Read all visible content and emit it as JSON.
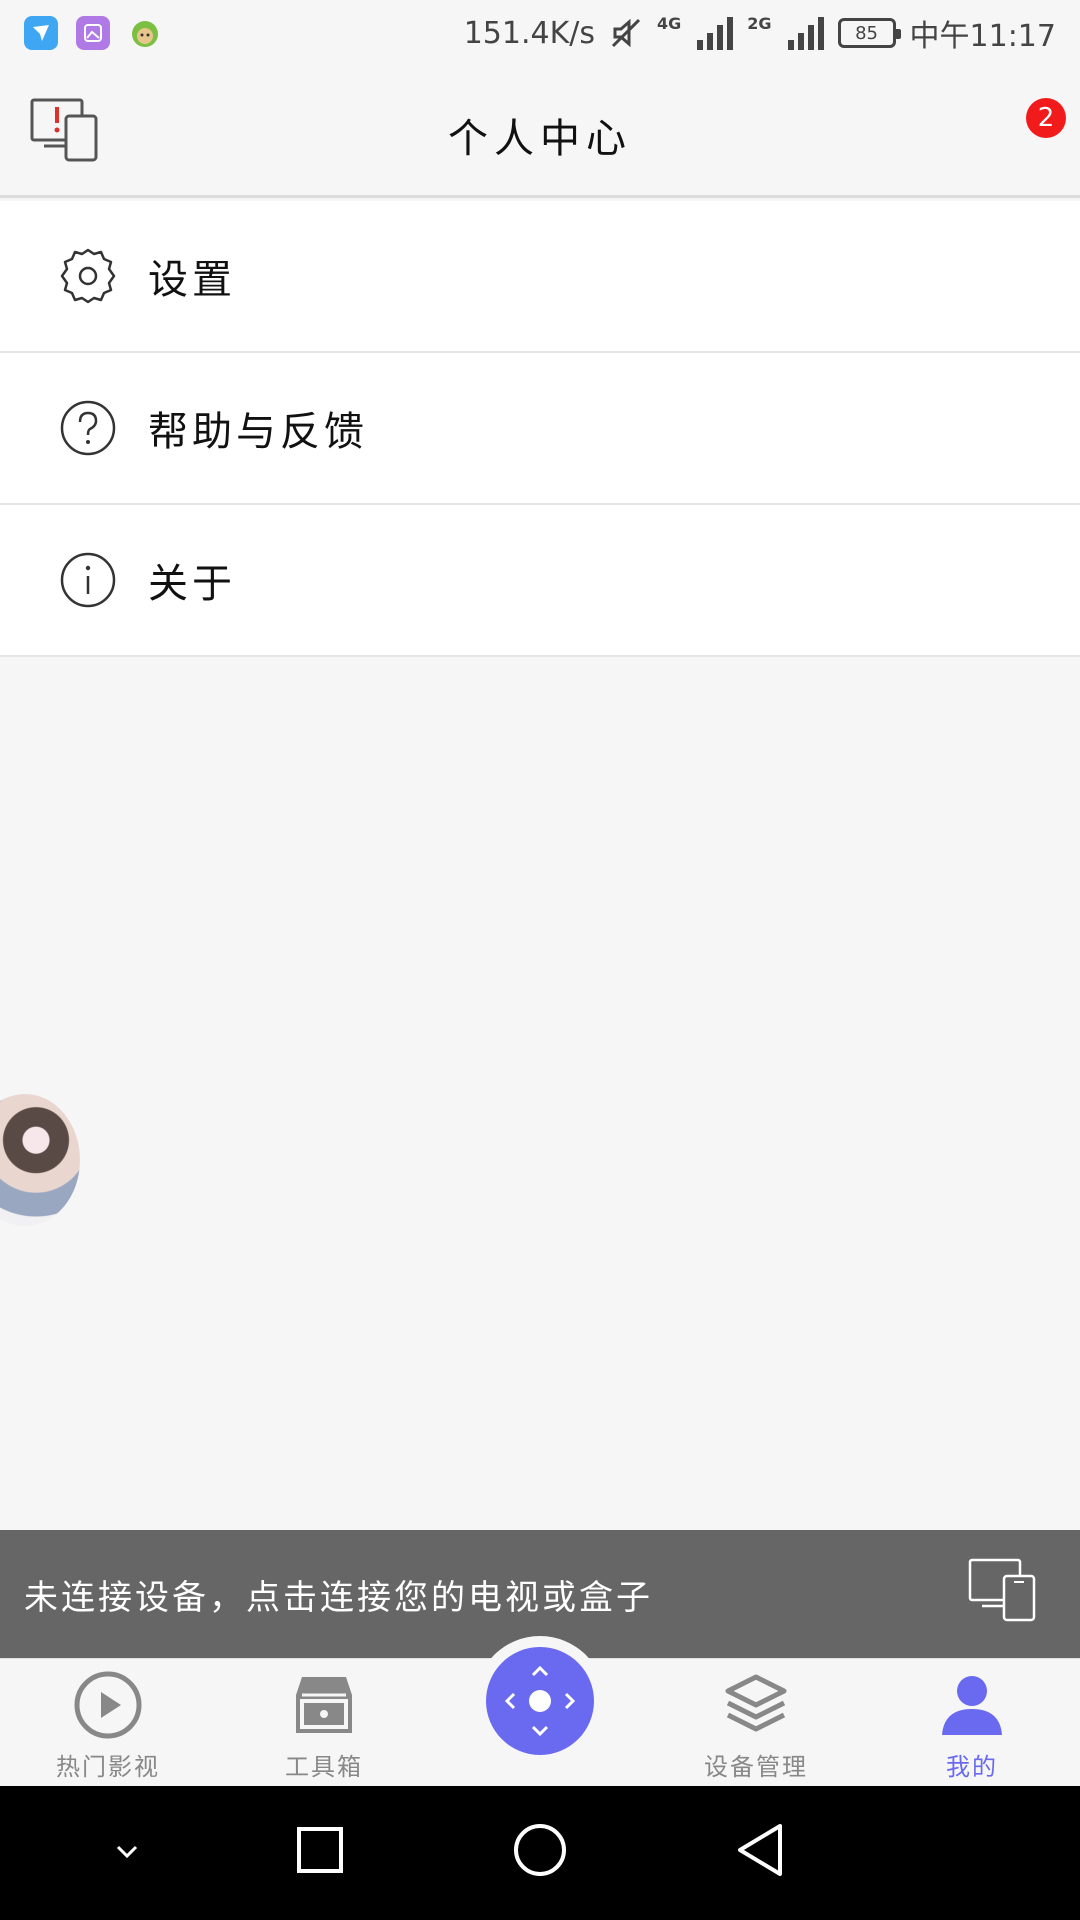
{
  "status_bar": {
    "speed": "151.4K/s",
    "net1": "4G",
    "net2": "2G",
    "battery": "85",
    "time": "中午11:17",
    "icons": [
      "message-app-icon",
      "gallery-app-icon",
      "monkey-app-icon",
      "mute-icon",
      "signal-icon",
      "battery-icon"
    ]
  },
  "header": {
    "title": "个人中心",
    "notification_count": "2",
    "left_icon": "device-screen-icon"
  },
  "menu": {
    "items": [
      {
        "label": "设置",
        "icon": "gear-icon"
      },
      {
        "label": "帮助与反馈",
        "icon": "help-icon"
      },
      {
        "label": "关于",
        "icon": "info-icon"
      }
    ]
  },
  "banner": {
    "text": "未连接设备，点击连接您的电视或盒子",
    "icon": "device-screen-icon"
  },
  "tabs": [
    {
      "label": "热门影视",
      "icon": "play-icon",
      "active": false
    },
    {
      "label": "工具箱",
      "icon": "toolbox-icon",
      "active": false
    },
    {
      "label": "设备管理",
      "icon": "layers-icon",
      "active": false
    },
    {
      "label": "我的",
      "icon": "user-icon",
      "active": true
    }
  ],
  "colors": {
    "accent": "#6a6af0",
    "badge": "#f21b1b",
    "banner_bg": "#666666"
  }
}
